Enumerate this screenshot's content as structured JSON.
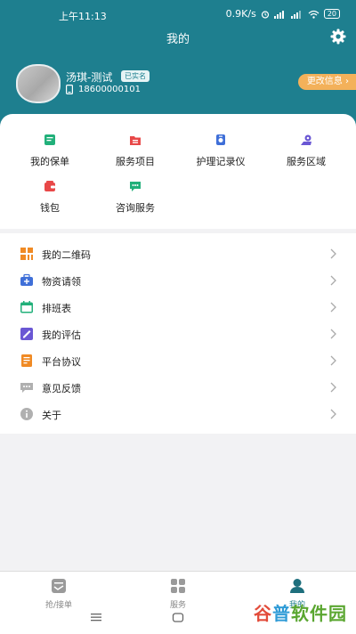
{
  "status_bar": {
    "time": "上午11:13",
    "speed": "0.9K/s",
    "battery": "20"
  },
  "header": {
    "title": "我的"
  },
  "profile": {
    "name": "汤琪-测试",
    "badge": "已实名",
    "phone": "18600000101",
    "edit_label": "更改信息"
  },
  "grid": [
    {
      "label": "我的保单",
      "icon": "policy-icon",
      "color": "#21b07a"
    },
    {
      "label": "服务项目",
      "icon": "service-items-icon",
      "color": "#e84848"
    },
    {
      "label": "护理记录仪",
      "icon": "recorder-icon",
      "color": "#3f6fd8"
    },
    {
      "label": "服务区域",
      "icon": "area-icon",
      "color": "#6a57d4"
    },
    {
      "label": "钱包",
      "icon": "wallet-icon",
      "color": "#e84848"
    },
    {
      "label": "咨询服务",
      "icon": "consult-icon",
      "color": "#21b07a"
    }
  ],
  "menu": [
    {
      "label": "我的二维码",
      "icon": "qrcode-icon",
      "color": "#f08a24"
    },
    {
      "label": "物资请领",
      "icon": "supplies-icon",
      "color": "#3f6fd8"
    },
    {
      "label": "排班表",
      "icon": "calendar-icon",
      "color": "#21b07a"
    },
    {
      "label": "我的评估",
      "icon": "assessment-icon",
      "color": "#6a57d4"
    },
    {
      "label": "平台协议",
      "icon": "agreement-icon",
      "color": "#f08a24"
    },
    {
      "label": "意见反馈",
      "icon": "feedback-icon",
      "color": "#b0b0b0"
    },
    {
      "label": "关于",
      "icon": "info-icon",
      "color": "#b0b0b0"
    }
  ],
  "tabs": [
    {
      "label": "抢/接单",
      "icon": "grab-order-icon"
    },
    {
      "label": "服务",
      "icon": "service-grid-icon"
    },
    {
      "label": "我的",
      "icon": "profile-icon"
    }
  ],
  "watermark": "谷普软件园",
  "colors": {
    "header": "#1e7f8f",
    "accent_orange": "#f3b15a"
  }
}
